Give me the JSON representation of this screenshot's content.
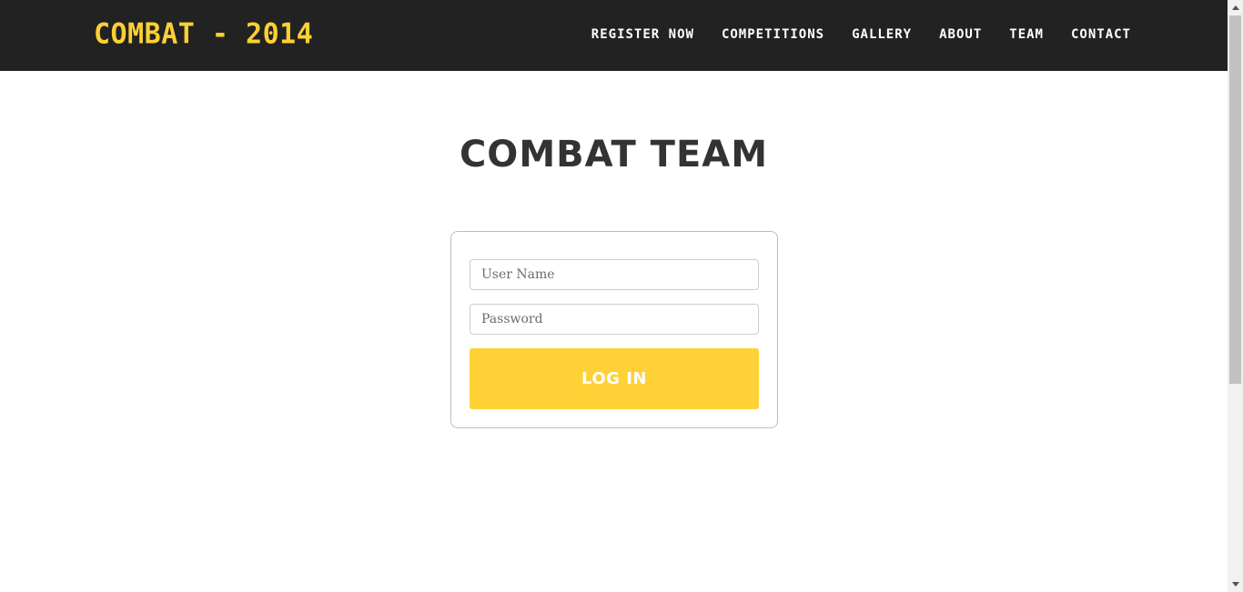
{
  "colors": {
    "navbar_bg": "#222222",
    "brand": "#fdd033",
    "title": "#333333",
    "button_bg": "#fed136",
    "button_text": "#ffffff"
  },
  "navbar": {
    "brand": "COMBAT - 2014",
    "links": [
      {
        "label": "REGISTER NOW"
      },
      {
        "label": "COMPETITIONS"
      },
      {
        "label": "GALLERY"
      },
      {
        "label": "ABOUT"
      },
      {
        "label": "TEAM"
      },
      {
        "label": "CONTACT"
      }
    ]
  },
  "main": {
    "title": "COMBAT TEAM",
    "login_form": {
      "username_placeholder": "User Name",
      "username_value": "",
      "password_placeholder": "Password",
      "password_value": "",
      "submit_label": "LOG IN"
    }
  }
}
